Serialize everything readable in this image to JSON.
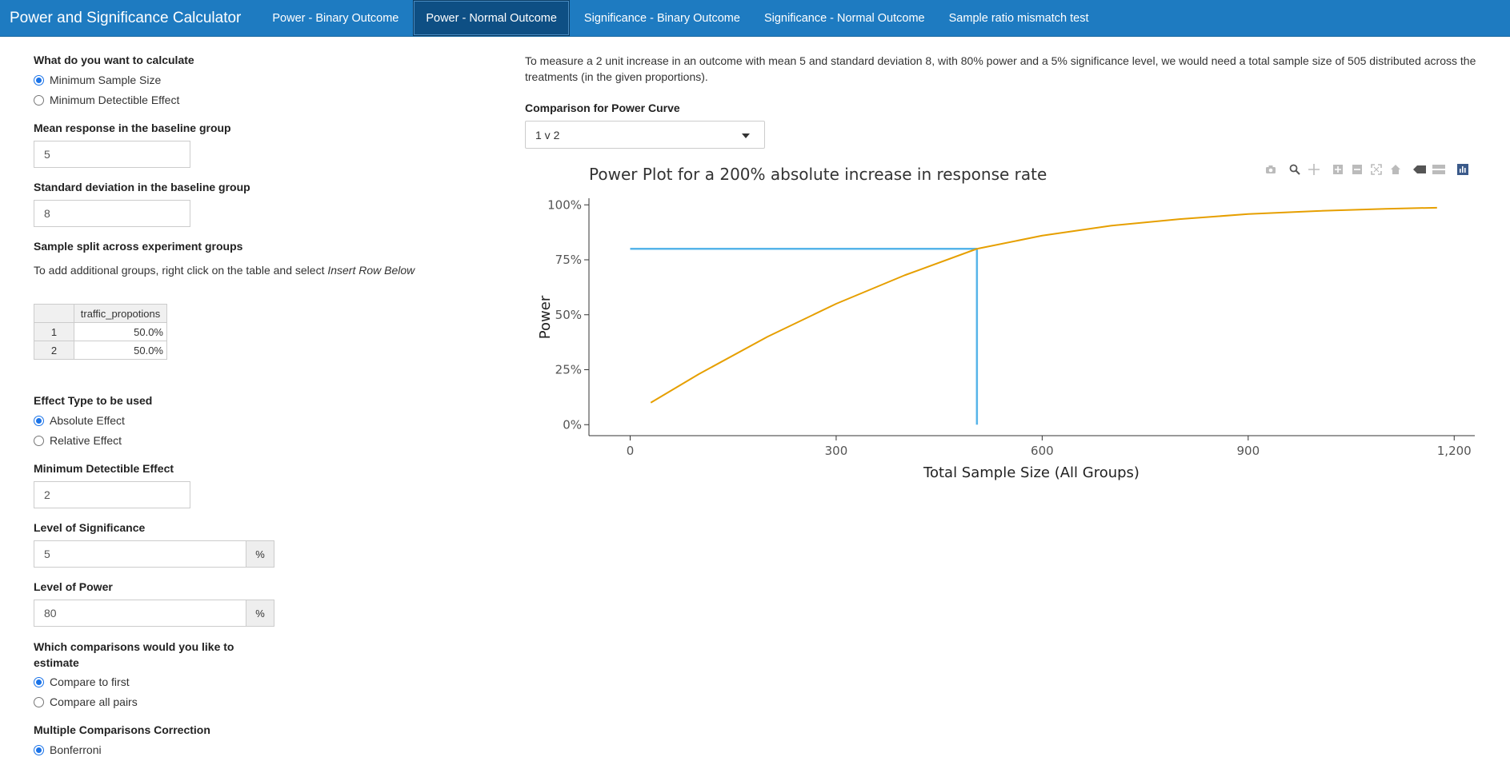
{
  "navbar": {
    "brand": "Power and Significance Calculator",
    "tabs": [
      {
        "label": "Power - Binary Outcome",
        "active": false
      },
      {
        "label": "Power - Normal Outcome",
        "active": true
      },
      {
        "label": "Significance - Binary Outcome",
        "active": false
      },
      {
        "label": "Significance - Normal Outcome",
        "active": false
      },
      {
        "label": "Sample ratio mismatch test",
        "active": false
      }
    ]
  },
  "sidebar": {
    "calc": {
      "label": "What do you want to calculate",
      "options": [
        {
          "label": "Minimum Sample Size",
          "checked": true
        },
        {
          "label": "Minimum Detectible Effect",
          "checked": false
        }
      ]
    },
    "mean": {
      "label": "Mean response in the baseline group",
      "value": "5"
    },
    "sd": {
      "label": "Standard deviation in the baseline group",
      "value": "8"
    },
    "split": {
      "label": "Sample split across experiment groups",
      "hint_prefix": "To add additional groups, right click on the table and select ",
      "hint_italic": "Insert Row Below",
      "column": "traffic_propotions",
      "rows": [
        {
          "id": "1",
          "value": "50.0%"
        },
        {
          "id": "2",
          "value": "50.0%"
        }
      ]
    },
    "effect_type": {
      "label": "Effect Type to be used",
      "options": [
        {
          "label": "Absolute Effect",
          "checked": true
        },
        {
          "label": "Relative Effect",
          "checked": false
        }
      ]
    },
    "mde": {
      "label": "Minimum Detectible Effect",
      "value": "2"
    },
    "significance": {
      "label": "Level of Significance",
      "value": "5",
      "addon": "%"
    },
    "power": {
      "label": "Level of Power",
      "value": "80",
      "addon": "%"
    },
    "comparisons": {
      "label": "Which comparisons would you like to estimate",
      "options": [
        {
          "label": "Compare to first",
          "checked": true
        },
        {
          "label": "Compare all pairs",
          "checked": false
        }
      ]
    },
    "correction": {
      "label": "Multiple Comparisons Correction",
      "options": [
        {
          "label": "Bonferroni",
          "checked": true
        }
      ]
    }
  },
  "main": {
    "description": "To measure a 2 unit increase in an outcome with mean 5 and standard deviation 8, with 80% power and a 5% significance level, we would need a total sample size of 505 distributed across the treatments (in the given proportions).",
    "comparison": {
      "label": "Comparison for Power Curve",
      "value": "1 v 2"
    }
  },
  "colors": {
    "accent": "#1e7bc1",
    "curve": "#e69f00",
    "marker": "#56b4e9"
  },
  "chart_data": {
    "type": "line",
    "title": "Power Plot for a 200% absolute increase in response rate",
    "xlabel": "Total Sample Size (All Groups)",
    "ylabel": "Power",
    "xlim": [
      -60,
      1230
    ],
    "ylim": [
      -0.05,
      1.03
    ],
    "xticks": [
      0,
      300,
      600,
      900,
      1200
    ],
    "xtick_labels": [
      "0",
      "300",
      "600",
      "900",
      "1,200"
    ],
    "yticks": [
      0,
      0.25,
      0.5,
      0.75,
      1.0
    ],
    "ytick_labels": [
      "0%",
      "25%",
      "50%",
      "75%",
      "100%"
    ],
    "series": [
      {
        "color": "#e69f00",
        "x": [
          30,
          100,
          200,
          300,
          400,
          505,
          600,
          700,
          800,
          900,
          1000,
          1100,
          1175
        ],
        "y": [
          0.1,
          0.23,
          0.4,
          0.55,
          0.68,
          0.8,
          0.86,
          0.905,
          0.935,
          0.958,
          0.972,
          0.982,
          0.987
        ]
      }
    ],
    "reference_lines": [
      {
        "color": "#56b4e9",
        "x": [
          0,
          505
        ],
        "y": [
          0.8,
          0.8
        ]
      },
      {
        "color": "#56b4e9",
        "x": [
          505,
          505
        ],
        "y": [
          0.8,
          0
        ]
      }
    ],
    "grid": false
  }
}
